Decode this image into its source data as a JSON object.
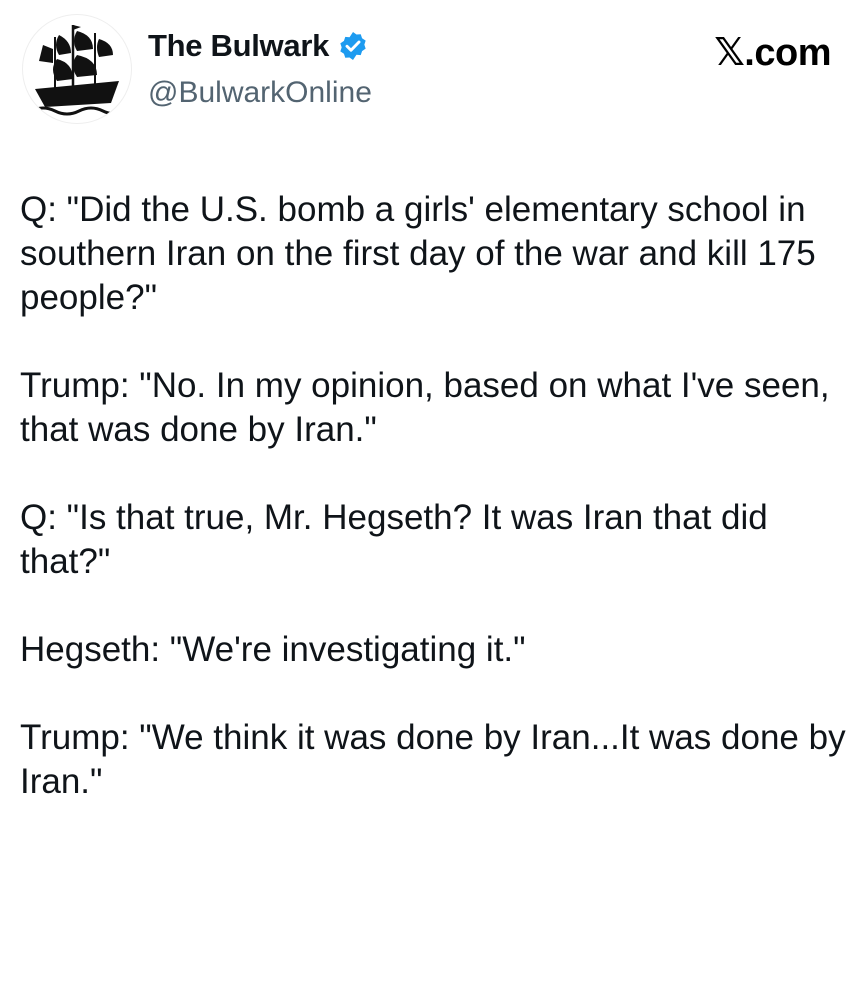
{
  "author": {
    "display_name": "The Bulwark",
    "handle": "@BulwarkOnline",
    "verified": true,
    "avatar_icon": "pirate-ship-logo",
    "verified_icon": "verified-badge-icon",
    "verified_color": "#1d9bf0"
  },
  "site_mark": "𝕏.com",
  "tweet": {
    "paragraphs": [
      "Q: \"Did the U.S. bomb a girls' elementary school in southern Iran on the first day of the war and kill 175 people?\"",
      "Trump: \"No. In my opinion, based on what I've seen, that was done by Iran.\"",
      "Q: \"Is that true, Mr. Hegseth? It was Iran that did that?\"",
      "Hegseth: \"We're investigating it.\"",
      "Trump: \"We think it was done by Iran...It was done by Iran.\""
    ]
  }
}
